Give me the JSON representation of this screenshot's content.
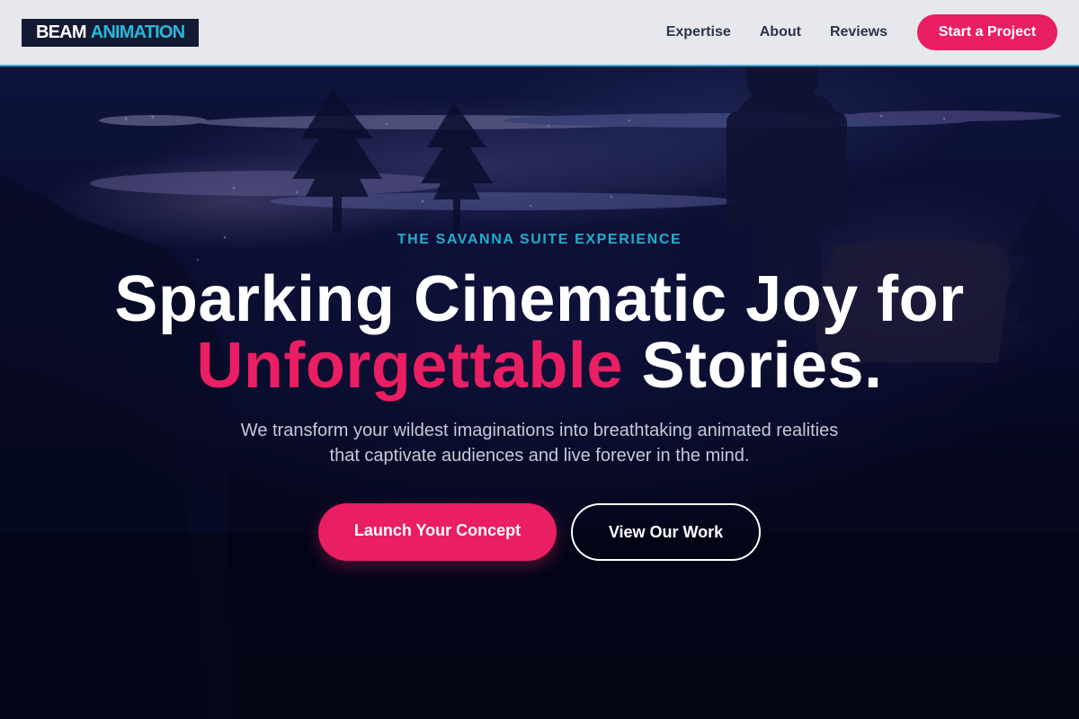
{
  "header": {
    "logo": {
      "word1": "BEAM",
      "word2": "ANIMATION"
    },
    "nav": [
      {
        "label": "Expertise"
      },
      {
        "label": "About"
      },
      {
        "label": "Reviews"
      }
    ],
    "cta_label": "Start a Project"
  },
  "hero": {
    "kicker": "THE SAVANNA SUITE EXPERIENCE",
    "headline_line1": "Sparking Cinematic Joy for",
    "headline_accent": "Unforgettable",
    "headline_rest": "Stories.",
    "subtitle_line1": "We transform your wildest imaginations into breathtaking animated realities",
    "subtitle_line2": "that captivate audiences and live forever in the mind.",
    "primary_button": "Launch Your Concept",
    "secondary_button": "View Our Work"
  },
  "colors": {
    "accent": "#e91e63",
    "brand_cyan": "#1fb7d4",
    "header_bg": "#e6e8ed",
    "hero_bg": "#05061a"
  }
}
